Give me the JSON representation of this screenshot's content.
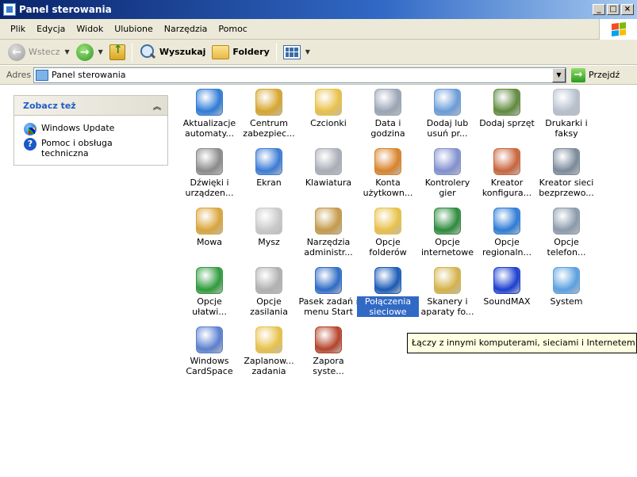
{
  "window": {
    "title": "Panel sterowania",
    "buttons": [
      "_",
      "□",
      "×"
    ]
  },
  "menubar": {
    "items": [
      "Plik",
      "Edycja",
      "Widok",
      "Ulubione",
      "Narzędzia",
      "Pomoc"
    ]
  },
  "toolbar": {
    "back_label": "Wstecz",
    "search_label": "Wyszukaj",
    "folders_label": "Foldery"
  },
  "address": {
    "label": "Adres",
    "value": "Panel sterowania",
    "go_label": "Przejdź"
  },
  "task_pane": {
    "title": "Zobacz też",
    "links": [
      {
        "label": "Windows Update",
        "icon": "windows-update-icon"
      },
      {
        "label": "Pomoc i obsługa techniczna",
        "icon": "help-icon"
      }
    ]
  },
  "icons": [
    {
      "label": "Aktualizacje automaty...",
      "icon": "automatic-updates-icon",
      "color": "#2e7bd6"
    },
    {
      "label": "Centrum zabezpiec...",
      "icon": "security-center-icon",
      "color": "#d6a52e"
    },
    {
      "label": "Czcionki",
      "icon": "fonts-icon",
      "color": "#e8c14a"
    },
    {
      "label": "Data i godzina",
      "icon": "date-time-icon",
      "color": "#9aa4b5"
    },
    {
      "label": "Dodaj lub usuń pr...",
      "icon": "add-remove-programs-icon",
      "color": "#6a9bd8"
    },
    {
      "label": "Dodaj sprzęt",
      "icon": "add-hardware-icon",
      "color": "#5f8a3c"
    },
    {
      "label": "Drukarki i faksy",
      "icon": "printers-faxes-icon",
      "color": "#b7c0cc"
    },
    {
      "label": "Dźwięki i urządzen...",
      "icon": "sounds-icon",
      "color": "#8a8a8a"
    },
    {
      "label": "Ekran",
      "icon": "display-icon",
      "color": "#3a7bd5"
    },
    {
      "label": "Klawiatura",
      "icon": "keyboard-icon",
      "color": "#a9adb6"
    },
    {
      "label": "Konta użytkown...",
      "icon": "user-accounts-icon",
      "color": "#d9822b"
    },
    {
      "label": "Kontrolery gier",
      "icon": "game-controllers-icon",
      "color": "#8090d0"
    },
    {
      "label": "Kreator konfigura...",
      "icon": "network-setup-icon",
      "color": "#c8643c"
    },
    {
      "label": "Kreator sieci bezprzewo...",
      "icon": "wireless-network-icon",
      "color": "#7a8a9a"
    },
    {
      "label": "Mowa",
      "icon": "speech-icon",
      "color": "#d9a53a"
    },
    {
      "label": "Mysz",
      "icon": "mouse-icon",
      "color": "#c9c9c9"
    },
    {
      "label": "Narzędzia administr...",
      "icon": "admin-tools-icon",
      "color": "#c49a4a"
    },
    {
      "label": "Opcje folderów",
      "icon": "folder-options-icon",
      "color": "#e8c14a"
    },
    {
      "label": "Opcje internetowe",
      "icon": "internet-options-icon",
      "color": "#2d8a3c"
    },
    {
      "label": "Opcje regionaln...",
      "icon": "regional-options-icon",
      "color": "#2e7bd6"
    },
    {
      "label": "Opcje telefon...",
      "icon": "phone-modem-icon",
      "color": "#8a9aaa"
    },
    {
      "label": "Opcje ułatwi...",
      "icon": "accessibility-icon",
      "color": "#2d9b3c"
    },
    {
      "label": "Opcje zasilania",
      "icon": "power-options-icon",
      "color": "#b0b0b0"
    },
    {
      "label": "Pasek zadań i menu Start",
      "icon": "taskbar-start-icon",
      "color": "#2e6bc6"
    },
    {
      "label": "Połączenia sieciowe",
      "icon": "network-connections-icon",
      "color": "#1a5ab7"
    },
    {
      "label": "Skanery i aparaty fo...",
      "icon": "scanners-cameras-icon",
      "color": "#d4b24a"
    },
    {
      "label": "SoundMAX",
      "icon": "soundmax-icon",
      "color": "#1b3fd0"
    },
    {
      "label": "System",
      "icon": "system-icon",
      "color": "#5aa0e0"
    },
    {
      "label": "Windows CardSpace",
      "icon": "cardspace-icon",
      "color": "#5a7fd0"
    },
    {
      "label": "Zaplanow... zadania",
      "icon": "scheduled-tasks-icon",
      "color": "#e8c14a"
    },
    {
      "label": "Zapora syste...",
      "icon": "firewall-icon",
      "color": "#b5432a"
    }
  ],
  "selected_icon": "Połączenia sieciowe",
  "tooltip": "Łączy z innymi komputerami, sieciami i Internetem"
}
